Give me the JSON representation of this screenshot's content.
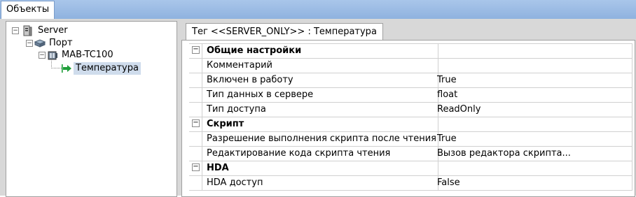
{
  "top_tab": "Объекты",
  "tree": {
    "server": "Server",
    "port": "Порт",
    "device": "MAB-TC100",
    "tag": "Температура"
  },
  "detail_tab": "Тег  <<SERVER_ONLY>> : Температура",
  "properties": [
    {
      "label": "Общие настройки",
      "value": "",
      "header": true
    },
    {
      "label": "Комментарий",
      "value": ""
    },
    {
      "label": "Включен в работу",
      "value": "True"
    },
    {
      "label": "Тип данных в сервере",
      "value": "float"
    },
    {
      "label": "Тип доступа",
      "value": "ReadOnly"
    },
    {
      "label": "Скрипт",
      "value": "",
      "header": true
    },
    {
      "label": "Разрешение выполнения скрипта после чтения",
      "value": "True"
    },
    {
      "label": "Редактирование кода скрипта чтения",
      "value": "Вызов редактора скрипта..."
    },
    {
      "label": "HDA",
      "value": "",
      "header": true
    },
    {
      "label": "HDA доступ",
      "value": "False"
    }
  ],
  "icons": {
    "server": "server-icon",
    "port": "port-icon",
    "device": "device-icon",
    "tag": "tag-arrow-icon"
  },
  "colors": {
    "accent": "#8fb2df",
    "selection": "#cfdcec",
    "tag_arrow": "#1f9e3a"
  }
}
